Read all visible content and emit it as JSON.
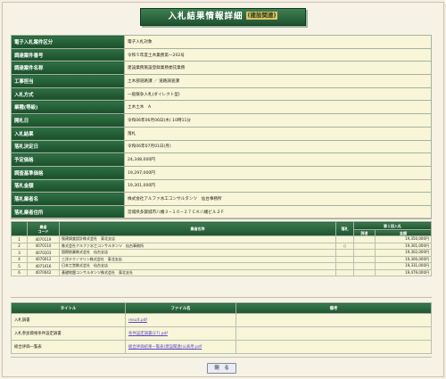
{
  "header": {
    "title": "入札結果情報詳細",
    "subtitle": "(建設関連)"
  },
  "details": [
    {
      "label": "電子入札案件区分",
      "value": "電子入札対象"
    },
    {
      "label": "調達案件番号",
      "value": "令和５年度土木業務第ー202号"
    },
    {
      "label": "調達案件名称",
      "value": "建設業務施設登録業務委託業務"
    },
    {
      "label": "工事担当",
      "value": "土木部道路課 ／ 道路調査課"
    },
    {
      "label": "入札方式",
      "value": "一般競争入札(ダイレクト型)"
    },
    {
      "label": "業種(等級)",
      "value": "土木土木　A"
    },
    {
      "label": "開札日",
      "value": "令和06年06月06日(木) 10時11分"
    },
    {
      "label": "入札結果",
      "value": "落札"
    },
    {
      "label": "落札決定日",
      "value": "令和06年07月01日(月)"
    },
    {
      "label": "予定価格",
      "value": "24,348,000円"
    },
    {
      "label": "調査基準価格",
      "value": "19,297,000円"
    },
    {
      "label": "落札金額",
      "value": "19,301,000円"
    },
    {
      "label": "落札業者名",
      "value": "株式会社アルファ水工コンサルタンツ　仙台事務所"
    },
    {
      "label": "落札業者住所",
      "value": "宮城県多賀城市八幡３−１０−２７ＣＫ八幡ビル２Ｆ"
    }
  ],
  "bids": {
    "headers": {
      "no": "",
      "code": "業者\nコード",
      "name": "業者名称",
      "award": "落札",
      "reason": "辞退",
      "group": "第１回入札",
      "amount": "金額"
    },
    "rows": [
      {
        "no": "1",
        "code": "4070119",
        "name": "復建調査設計株式会社　東北支店",
        "award": "",
        "reason": "",
        "amount": "19,350,000円"
      },
      {
        "no": "2",
        "code": "4070110",
        "name": "株式会社アルファ水工コンサルタンツ　仙台事務所",
        "award": "○",
        "reason": "",
        "amount": "19,301,000円"
      },
      {
        "no": "3",
        "code": "4070103",
        "name": "国際航業株式会社　仙台支店",
        "award": "",
        "reason": "",
        "amount": "19,302,000円"
      },
      {
        "no": "4",
        "code": "4070012",
        "name": "三洋テクノマリン株式会社　東北支店",
        "award": "",
        "reason": "",
        "amount": "19,300,000円"
      },
      {
        "no": "5",
        "code": "4071016",
        "name": "日本工営株式会社　仙台支店",
        "award": "",
        "reason": "",
        "amount": "19,331,000円"
      },
      {
        "no": "6",
        "code": "4070042",
        "name": "基礎地盤コンサルタンツ株式会社　東北支社",
        "award": "",
        "reason": "",
        "amount": "19,479,000円"
      }
    ]
  },
  "documents": {
    "headers": {
      "title": "タイトル",
      "file": "ファイル名",
      "remarks": "備考"
    },
    "rows": [
      {
        "title": "入札調書",
        "file": "result.pdf",
        "remarks": ""
      },
      {
        "title": "入札参加資格条件設定調書",
        "file": "条件設定調書(27).pdf",
        "remarks": ""
      },
      {
        "title": "総合評価一覧表",
        "file": "総合評価結果一覧表(建設関連)公表用.pdf",
        "remarks": ""
      }
    ]
  },
  "footer": {
    "close_label": "閉　る"
  }
}
